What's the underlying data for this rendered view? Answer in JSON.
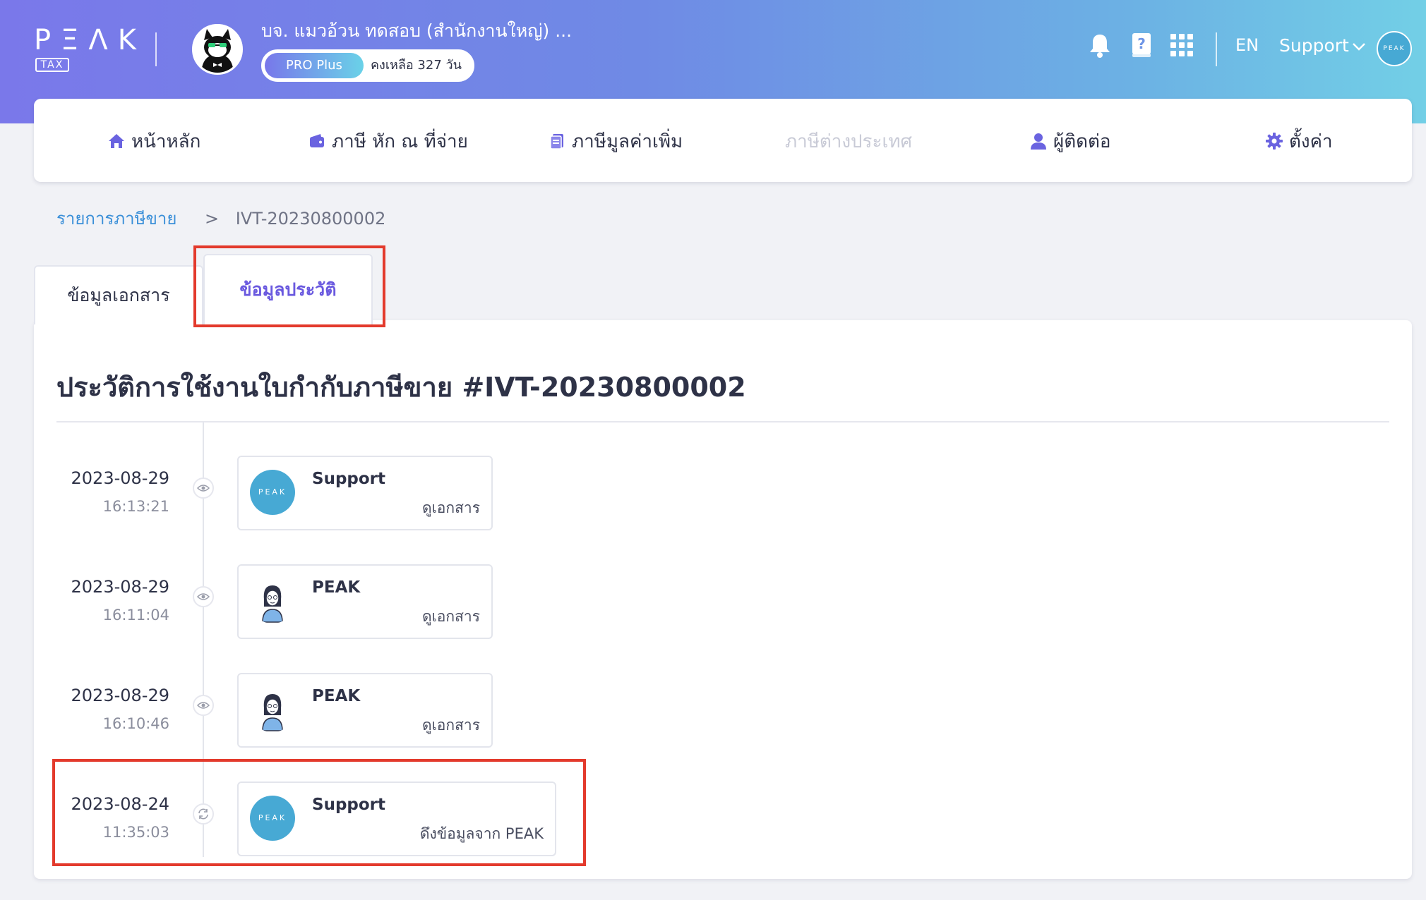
{
  "app": {
    "logo_text": "PΞΛK",
    "logo_tag": "TAX",
    "company_name": "บจ. แมวอ้วน ทดสอบ (สำนักงานใหญ่) ...",
    "plan_label": "PRO Plus",
    "plan_days": "คงเหลือ 327 วัน",
    "lang": "EN",
    "user_name": "Support",
    "user_avatar_text": "PEAK",
    "brand_color": "#6f8ae5",
    "icons": [
      "bell-icon",
      "help-book-icon",
      "apps-grid-icon",
      "chevron-down-icon"
    ]
  },
  "nav": {
    "items": [
      {
        "label": "หน้าหลัก",
        "icon": "home-icon"
      },
      {
        "label": "ภาษี หัก ณ ที่จ่าย",
        "icon": "wallet-icon"
      },
      {
        "label": "ภาษีมูลค่าเพิ่ม",
        "icon": "document-icon"
      },
      {
        "label": "ภาษีต่างประเทศ",
        "icon": "",
        "disabled": true
      },
      {
        "label": "ผู้ติดต่อ",
        "icon": "user-icon"
      },
      {
        "label": "ตั้งค่า",
        "icon": "gear-icon"
      }
    ]
  },
  "breadcrumb": {
    "parent": "รายการภาษีขาย",
    "separator": ">",
    "current": "IVT-20230800002"
  },
  "tabs": {
    "document": "ข้อมูลเอกสาร",
    "history": "ข้อมูลประวัติ"
  },
  "history": {
    "title": "ประวัติการใช้งานใบกำกับภาษีขาย #IVT-20230800002",
    "entries": [
      {
        "date": "2023-08-29",
        "time": "16:13:21",
        "user": "Support",
        "action": "ดูเอกสาร",
        "avatar": "PEAK",
        "icon": "eye-icon"
      },
      {
        "date": "2023-08-29",
        "time": "16:11:04",
        "user": "PEAK",
        "action": "ดูเอกสาร",
        "avatar": "woman",
        "icon": "eye-icon"
      },
      {
        "date": "2023-08-29",
        "time": "16:10:46",
        "user": "PEAK",
        "action": "ดูเอกสาร",
        "avatar": "woman",
        "icon": "eye-icon"
      },
      {
        "date": "2023-08-24",
        "time": "11:35:03",
        "user": "Support",
        "action": "ดึงข้อมูลจาก PEAK",
        "avatar": "PEAK",
        "icon": "sync-icon"
      }
    ]
  }
}
